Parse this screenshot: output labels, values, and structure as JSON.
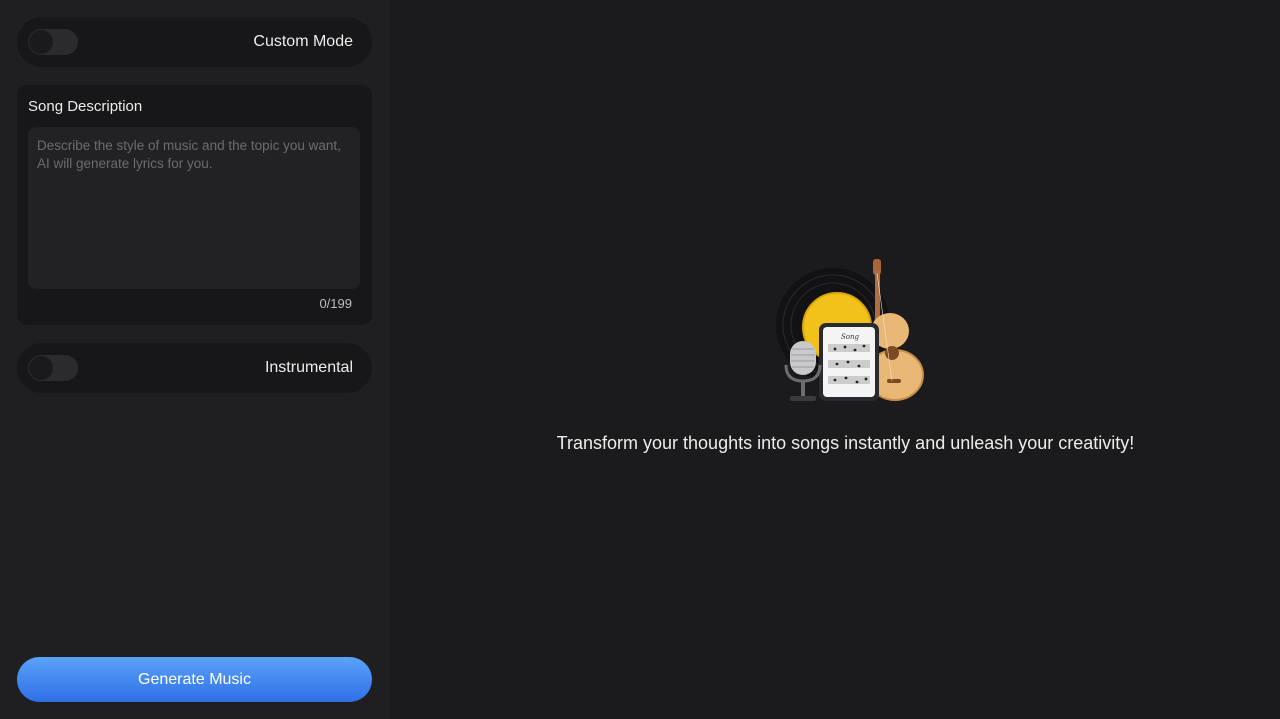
{
  "sidebar": {
    "custom_mode": {
      "label": "Custom Mode",
      "enabled": false
    },
    "song_description": {
      "title": "Song Description",
      "value": "",
      "placeholder": "Describe the style of music and the topic you want, AI will generate lyrics for you.",
      "counter": "0/199"
    },
    "instrumental": {
      "label": "Instrumental",
      "enabled": false
    },
    "generate_button": {
      "label": "Generate Music"
    }
  },
  "main": {
    "illustration_icon": "music-instruments-illustration",
    "illustration_sheet_title": "Song",
    "tagline": "Transform your thoughts into songs instantly and unleash your creativity!"
  },
  "colors": {
    "background": "#1b1b1d",
    "sidebar": "#1f1f21",
    "card": "#171719",
    "accent_start": "#5aa2f9",
    "accent_end": "#2f6fe6"
  }
}
